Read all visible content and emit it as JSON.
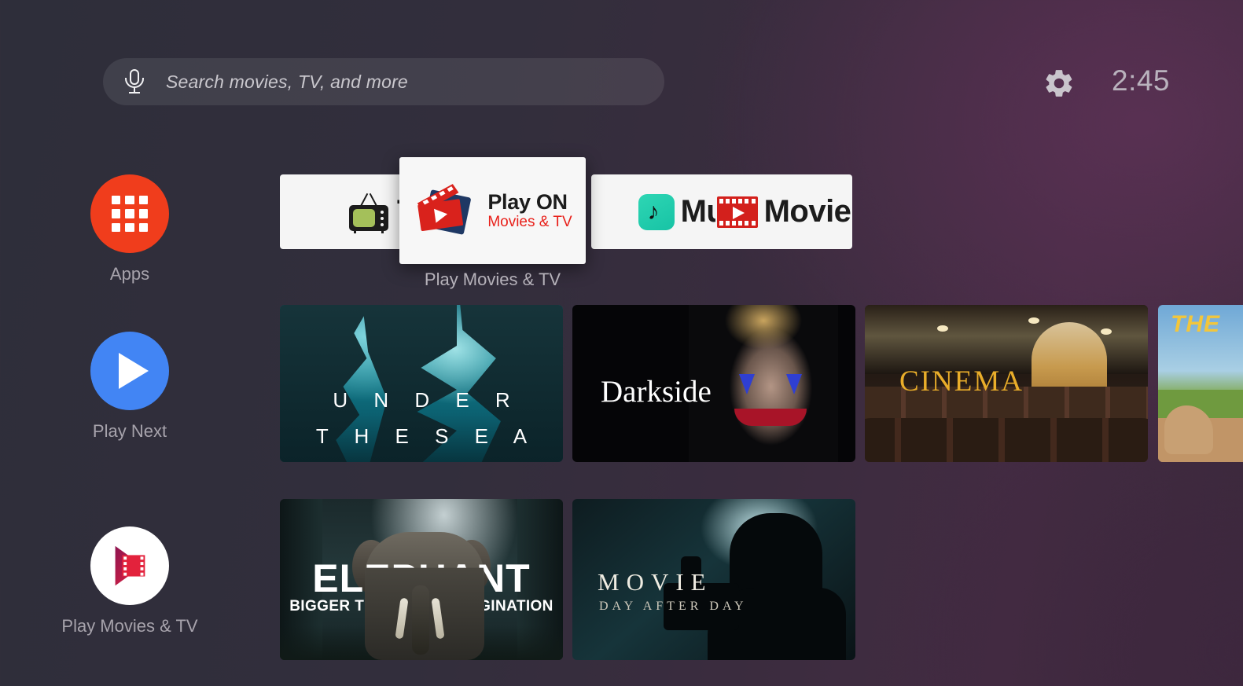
{
  "topbar": {
    "search": {
      "placeholder": "Search movies, TV, and more",
      "value": "",
      "mic_icon": "microphone-icon"
    },
    "settings_icon": "gear-icon",
    "clock": "2:45"
  },
  "sidebar": {
    "items": [
      {
        "label": "Apps",
        "icon": "apps-grid-icon",
        "color": "#f03d1c"
      },
      {
        "label": "Play Next",
        "icon": "play-triangle-icon",
        "color": "#4285f4"
      },
      {
        "label": "Play Movies & TV",
        "icon": "play-movies-tv-icon",
        "color": "#ffffff"
      }
    ]
  },
  "app_row": {
    "focused_label": "Play Movies & TV",
    "tiles": [
      {
        "name": "tv",
        "label": "TV",
        "icon": "retro-tv-icon",
        "focused": false
      },
      {
        "name": "play-on",
        "title": "Play ON",
        "subtitle": "Movies & TV",
        "icon": "clapperboard-play-icon",
        "focused": true,
        "subtitle_color": "#e8201a"
      },
      {
        "name": "music",
        "label": "Music",
        "icon": "music-note-icon",
        "focused": false
      },
      {
        "name": "movie",
        "label": "Movie",
        "icon": "filmstrip-play-icon",
        "focused": false
      }
    ]
  },
  "content": {
    "row1": [
      {
        "name": "under-the-sea",
        "line1": "U N D E R",
        "line2": "T H E  S E A"
      },
      {
        "name": "darkside",
        "line1": "Darkside"
      },
      {
        "name": "cinema",
        "line1": "CINEMA"
      },
      {
        "name": "the",
        "line1": "THE"
      }
    ],
    "row2": [
      {
        "name": "elephant",
        "line1": "ELEPHANT",
        "line2": "BIGGER THAN YOUR IMAGINATION"
      },
      {
        "name": "movie-day-after-day",
        "line1": "MOVIE",
        "line2": "DAY AFTER DAY"
      }
    ]
  },
  "colors": {
    "accent_red": "#e8201a",
    "apps_circle": "#f03d1c",
    "play_next_circle": "#4285f4",
    "bg_left": "#2e2e3a",
    "bg_right": "#432b42"
  }
}
